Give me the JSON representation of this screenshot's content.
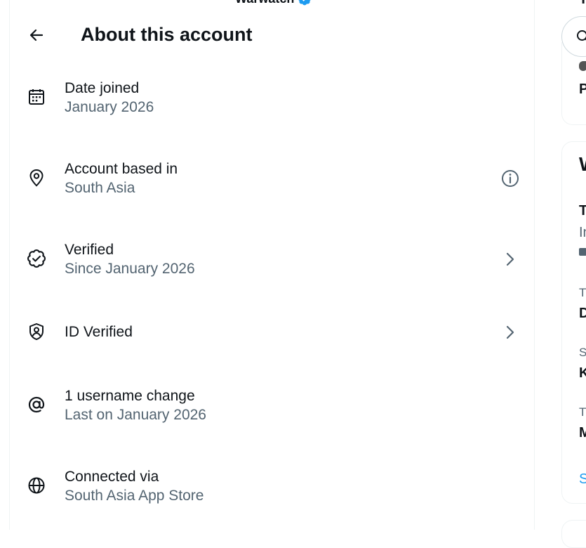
{
  "top_name": "Warwatch",
  "header": {
    "title": "About this account"
  },
  "rows": [
    {
      "label": "Date joined",
      "sub": "January 2026"
    },
    {
      "label": "Account based in",
      "sub": "South Asia"
    },
    {
      "label": "Verified",
      "sub": "Since January 2026"
    },
    {
      "label": "ID Verified",
      "sub": ""
    },
    {
      "label": "1 username change",
      "sub": "Last on January 2026"
    },
    {
      "label": "Connected via",
      "sub": "South Asia App Store"
    }
  ],
  "right": {
    "top_fragment": "T",
    "card1_fragment": "P",
    "card2_title_fragment": "W",
    "trend1": {
      "title": "T",
      "sub": "In"
    },
    "trend2": {
      "meta": "Tr",
      "title": "D"
    },
    "trend3": {
      "meta": "S",
      "title": "K"
    },
    "trend4": {
      "meta": "Tr",
      "title": "M"
    },
    "show_more_fragment": "S"
  },
  "colors": {
    "text": "#0f1419",
    "secondary": "#536471",
    "accent": "#1d9bf0",
    "border": "#eff3f4"
  }
}
